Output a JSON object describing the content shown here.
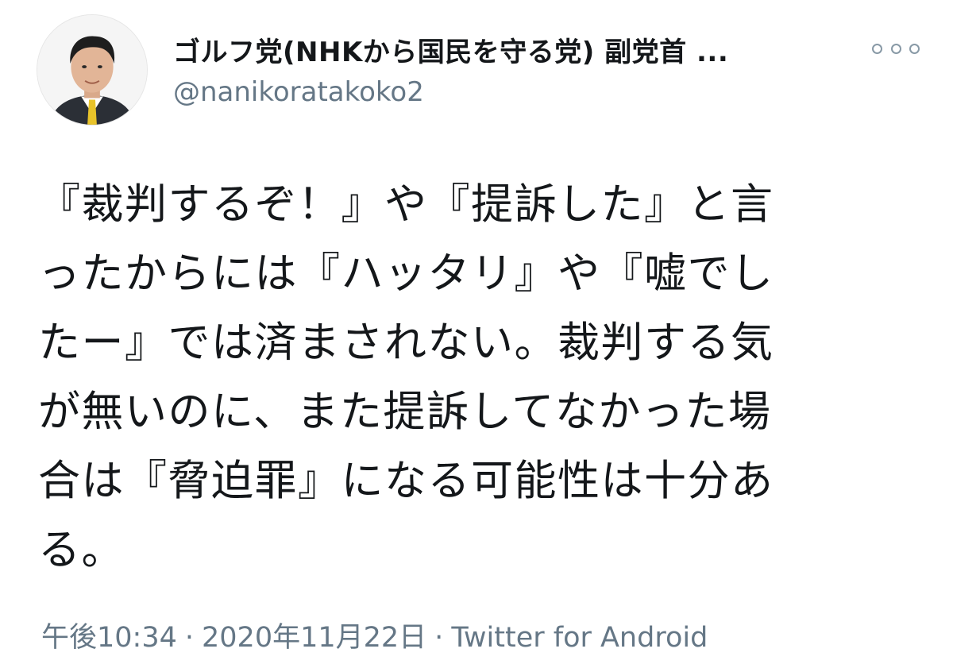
{
  "author": {
    "display_name": "ゴルフ党(NHKから国民を守る党) 副党首 ...",
    "handle": "@nanikoratakoko2"
  },
  "more_icon": "more-horizontal-icon",
  "tweet": {
    "lines": [
      "『裁判するぞ！』や『提訴した』と言",
      "ったからには『ハッタリ』や『嘘でし",
      "たー』では済まされない。裁判する気",
      "が無いのに、また提訴してなかった場",
      "合は『脅迫罪』になる可能性は十分あ",
      "る。"
    ]
  },
  "meta": {
    "time": "午後10:34",
    "separator": "·",
    "date": "2020年11月22日",
    "source": "Twitter for Android"
  },
  "colors": {
    "text": "#14171a",
    "secondary": "#657786",
    "icon": "#8899a6"
  }
}
